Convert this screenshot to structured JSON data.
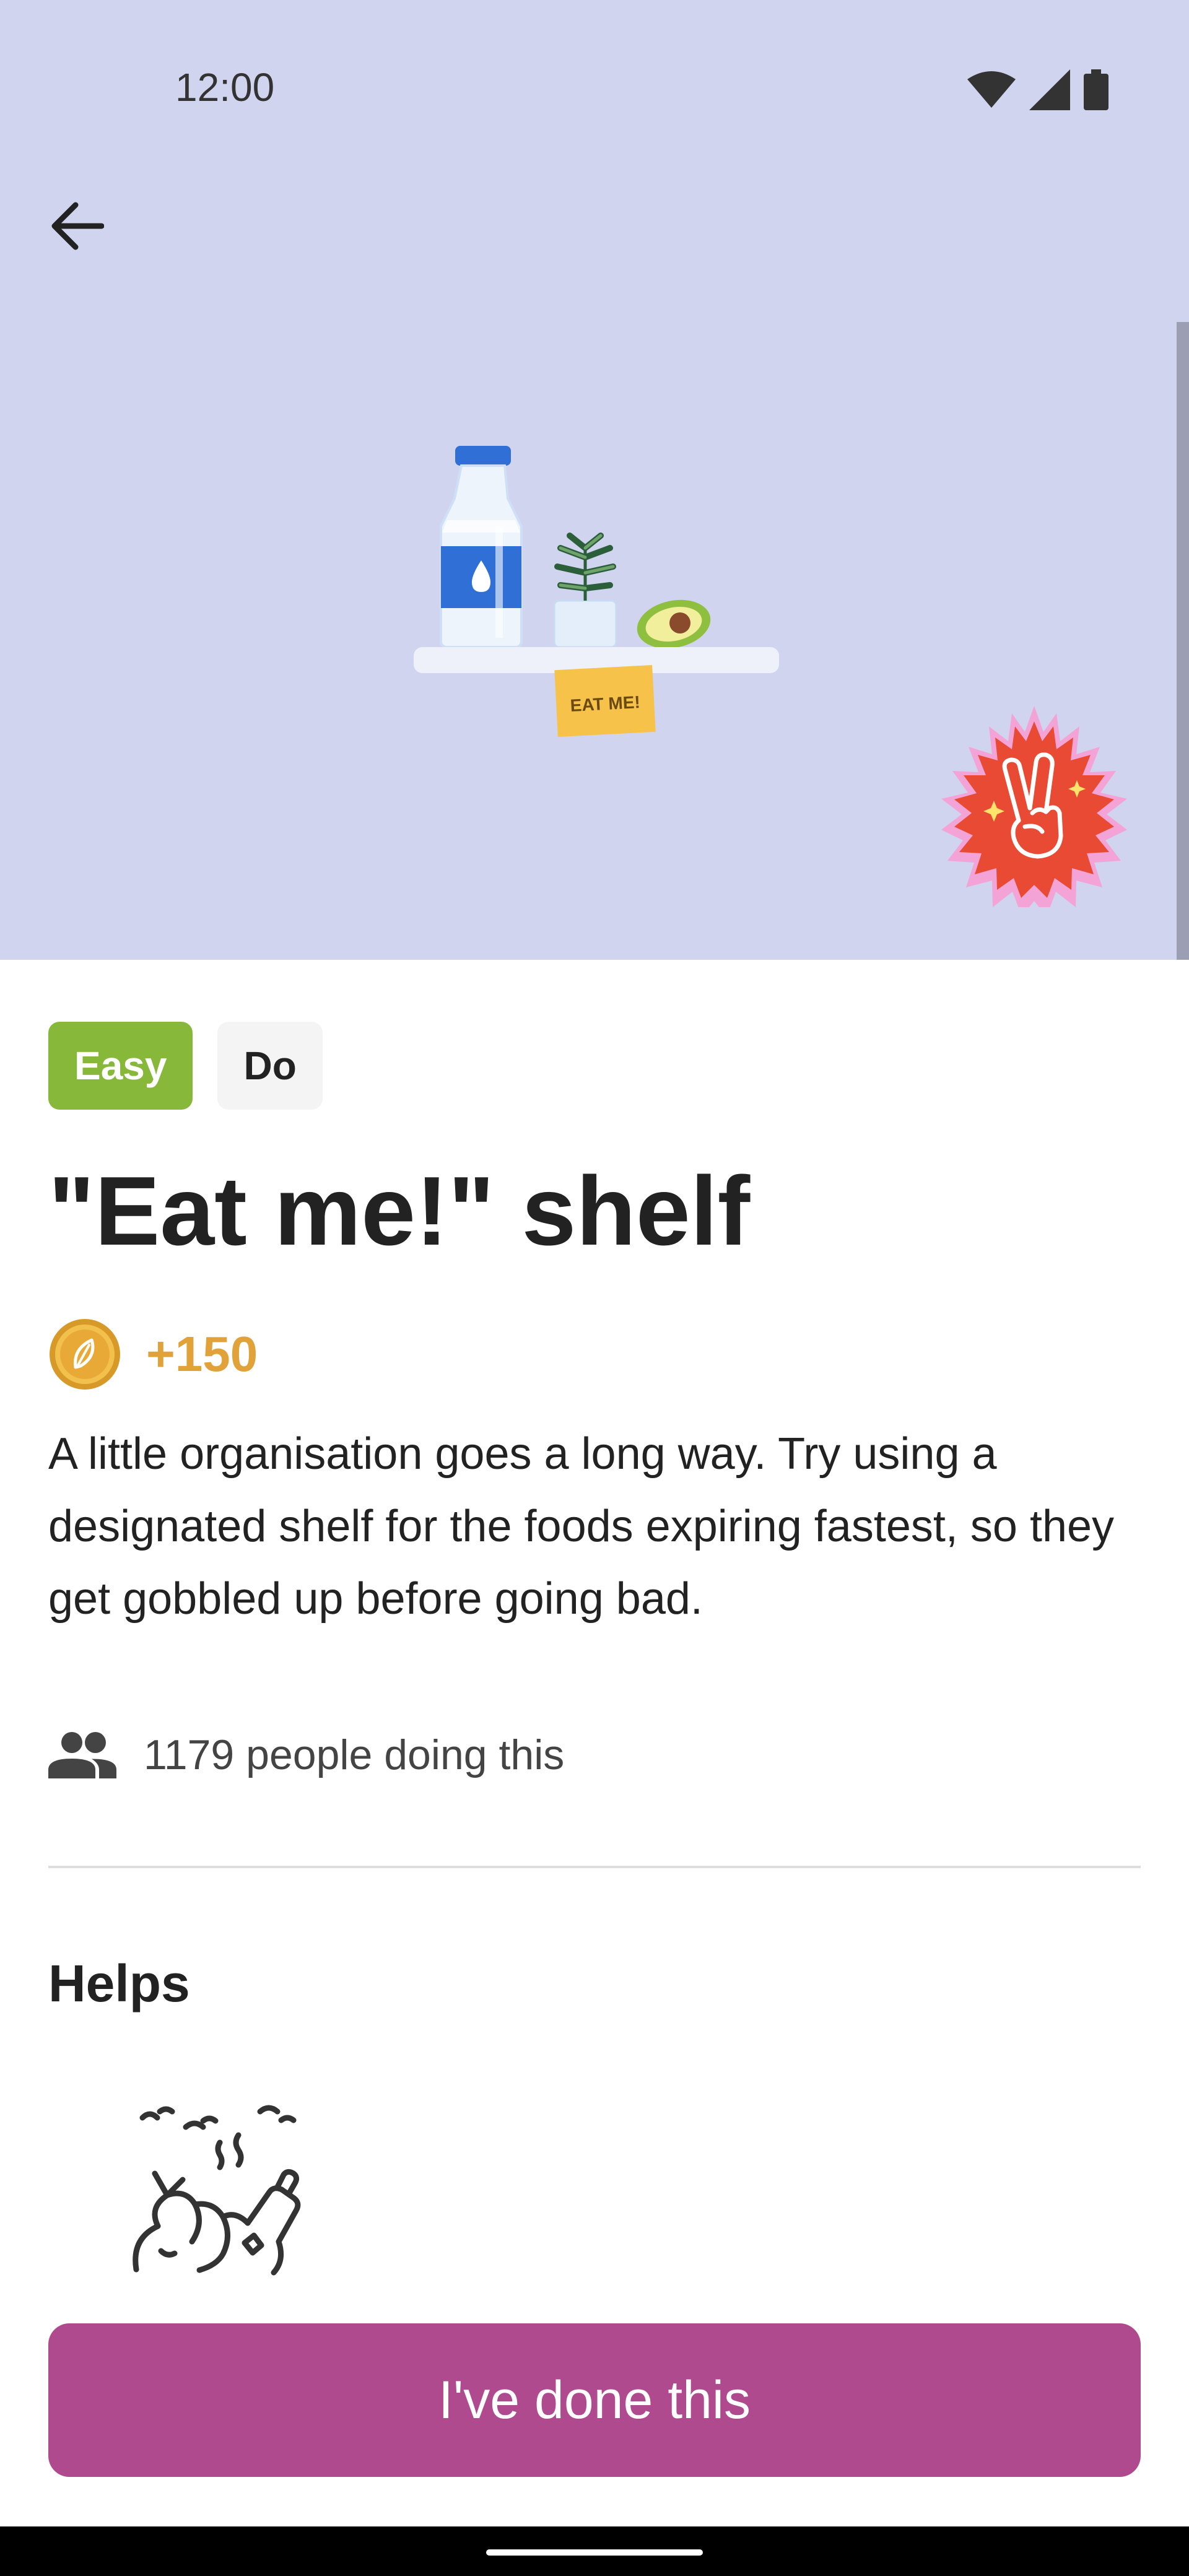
{
  "status_bar": {
    "time": "12:00",
    "icons": [
      "wifi-icon",
      "signal-icon",
      "battery-icon"
    ]
  },
  "header": {
    "back_icon": "arrow-left-icon"
  },
  "hero": {
    "background_color": "#d0d4ee",
    "illustration_text": "EAT ME!",
    "badge_icon": "peace-hand-icon"
  },
  "tags": {
    "difficulty": "Easy",
    "type": "Do"
  },
  "title": "\"Eat me!\" shelf",
  "points": {
    "value": "+150",
    "icon": "coin-icon"
  },
  "description": "A little organisation goes a long way. Try using a designated shelf for the foods expiring fastest, so they get gobbled up before going bad.",
  "participants": {
    "text": "1179 people doing this",
    "icon": "people-icon"
  },
  "helps": {
    "title": "Helps",
    "icon": "food-waste-icon"
  },
  "action": {
    "label": "I've done this"
  },
  "colors": {
    "accent": "#ae4a8d",
    "easy": "#88b83a",
    "points": "#e1a23a"
  }
}
